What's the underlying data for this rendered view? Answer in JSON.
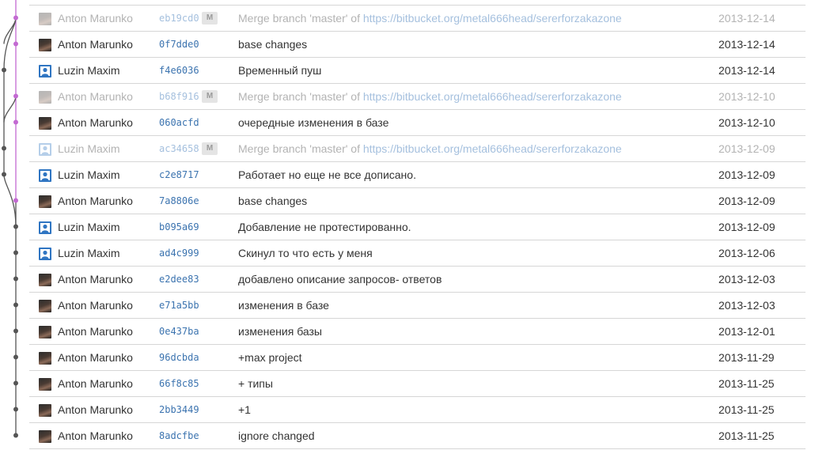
{
  "colors": {
    "merge_line": "#c36ad2",
    "main_line": "#555555",
    "link": "#3b73af"
  },
  "commits": [
    {
      "author": "Anton Marunko",
      "avatar": "anton-avatar",
      "hash": "eb19cd0",
      "merge": true,
      "badge": "M",
      "message": "Merge branch 'master' of ",
      "link": "https://bitbucket.org/metal666head/sererforzakazone",
      "date": "2013-12-14"
    },
    {
      "author": "Anton Marunko",
      "avatar": "anton-avatar",
      "hash": "0f7dde0",
      "merge": false,
      "message": "base changes",
      "date": "2013-12-14"
    },
    {
      "author": "Luzin Maxim",
      "avatar": "luzin-avatar",
      "hash": "f4e6036",
      "merge": false,
      "message": "Временный пуш",
      "date": "2013-12-14"
    },
    {
      "author": "Anton Marunko",
      "avatar": "anton-avatar",
      "hash": "b68f916",
      "merge": true,
      "badge": "M",
      "message": "Merge branch 'master' of ",
      "link": "https://bitbucket.org/metal666head/sererforzakazone",
      "date": "2013-12-10"
    },
    {
      "author": "Anton Marunko",
      "avatar": "anton-avatar",
      "hash": "060acfd",
      "merge": false,
      "message": "очередные изменения в базе",
      "date": "2013-12-10"
    },
    {
      "author": "Luzin Maxim",
      "avatar": "luzin-avatar",
      "hash": "ac34658",
      "merge": true,
      "badge": "M",
      "message": "Merge branch 'master' of ",
      "link": "https://bitbucket.org/metal666head/sererforzakazone",
      "date": "2013-12-09"
    },
    {
      "author": "Luzin Maxim",
      "avatar": "luzin-avatar",
      "hash": "c2e8717",
      "merge": false,
      "message": "Работает но еще не все дописано.",
      "date": "2013-12-09"
    },
    {
      "author": "Anton Marunko",
      "avatar": "anton-avatar",
      "hash": "7a8806e",
      "merge": false,
      "message": "base changes",
      "date": "2013-12-09"
    },
    {
      "author": "Luzin Maxim",
      "avatar": "luzin-avatar",
      "hash": "b095a69",
      "merge": false,
      "message": "Добавление не протестированно.",
      "date": "2013-12-09"
    },
    {
      "author": "Luzin Maxim",
      "avatar": "luzin-avatar",
      "hash": "ad4c999",
      "merge": false,
      "message": "Скинул то что есть у меня",
      "date": "2013-12-06"
    },
    {
      "author": "Anton Marunko",
      "avatar": "anton-avatar",
      "hash": "e2dee83",
      "merge": false,
      "message": "добавлено описание запросов- ответов",
      "date": "2013-12-03"
    },
    {
      "author": "Anton Marunko",
      "avatar": "anton-avatar",
      "hash": "e71a5bb",
      "merge": false,
      "message": "изменения в базе",
      "date": "2013-12-03"
    },
    {
      "author": "Anton Marunko",
      "avatar": "anton-avatar",
      "hash": "0e437ba",
      "merge": false,
      "message": "изменения базы",
      "date": "2013-12-01"
    },
    {
      "author": "Anton Marunko",
      "avatar": "anton-avatar",
      "hash": "96dcbda",
      "merge": false,
      "message": "+max project",
      "date": "2013-11-29"
    },
    {
      "author": "Anton Marunko",
      "avatar": "anton-avatar",
      "hash": "66f8c85",
      "merge": false,
      "message": "+ типы",
      "date": "2013-11-25"
    },
    {
      "author": "Anton Marunko",
      "avatar": "anton-avatar",
      "hash": "2bb3449",
      "merge": false,
      "message": "+1",
      "date": "2013-11-25"
    },
    {
      "author": "Anton Marunko",
      "avatar": "anton-avatar",
      "hash": "8adcfbe",
      "merge": false,
      "message": "ignore changed",
      "date": "2013-11-25"
    }
  ]
}
